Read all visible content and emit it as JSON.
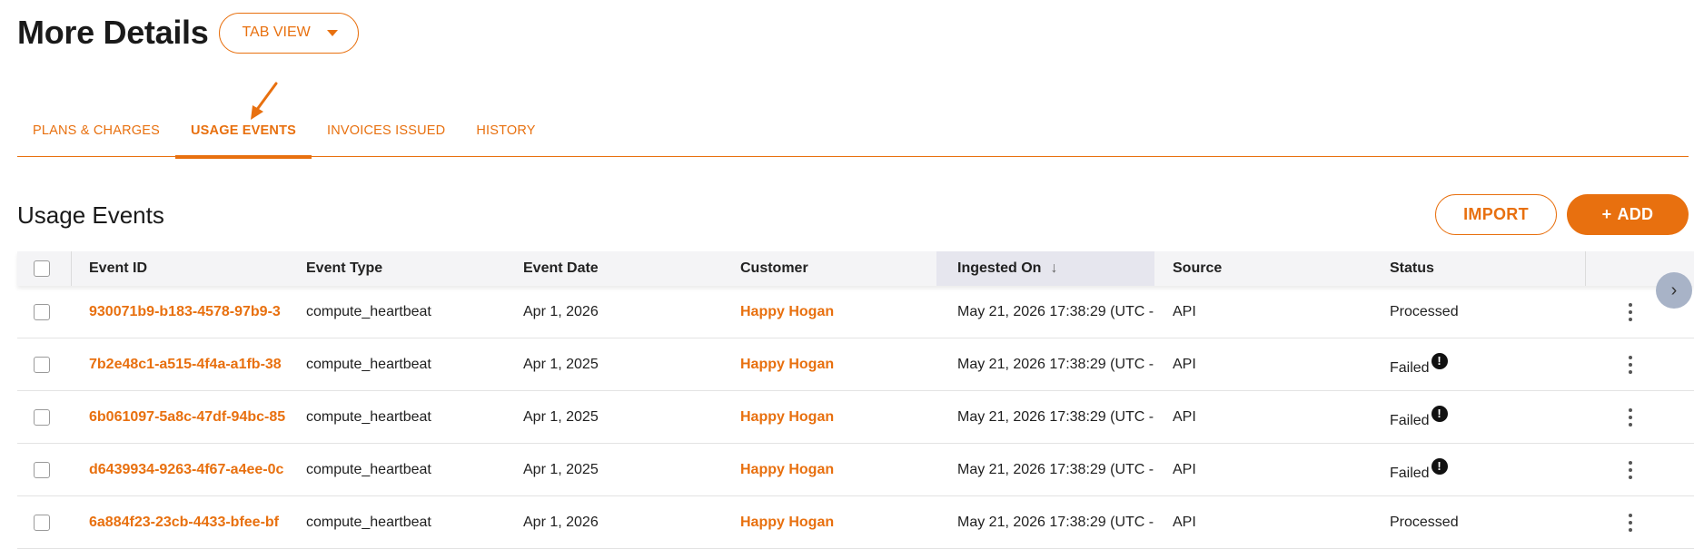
{
  "header": {
    "title": "More Details",
    "view_select": "TAB VIEW"
  },
  "tabs": [
    {
      "label": "PLANS & CHARGES",
      "active": false
    },
    {
      "label": "USAGE EVENTS",
      "active": true
    },
    {
      "label": "INVOICES ISSUED",
      "active": false
    },
    {
      "label": "HISTORY",
      "active": false
    }
  ],
  "section": {
    "title": "Usage Events",
    "import_label": "IMPORT",
    "add_label": "ADD",
    "add_icon": "plus-icon"
  },
  "table": {
    "columns": [
      "Event ID",
      "Event Type",
      "Event Date",
      "Customer",
      "Ingested On",
      "Source",
      "Status"
    ],
    "sort_icon": "arrow-down-icon",
    "rows": [
      {
        "id": "930071b9-b183-4578-97b9-3",
        "type": "compute_heartbeat",
        "date": "Apr 1, 2026",
        "customer": "Happy Hogan",
        "ingested": "May 21, 2026 17:38:29 (UTC -",
        "source": "API",
        "status": "Processed",
        "failed": false
      },
      {
        "id": "7b2e48c1-a515-4f4a-a1fb-38",
        "type": "compute_heartbeat",
        "date": "Apr 1, 2025",
        "customer": "Happy Hogan",
        "ingested": "May 21, 2026 17:38:29 (UTC -",
        "source": "API",
        "status": "Failed",
        "failed": true
      },
      {
        "id": "6b061097-5a8c-47df-94bc-85",
        "type": "compute_heartbeat",
        "date": "Apr 1, 2025",
        "customer": "Happy Hogan",
        "ingested": "May 21, 2026 17:38:29 (UTC -",
        "source": "API",
        "status": "Failed",
        "failed": true
      },
      {
        "id": "d6439934-9263-4f67-a4ee-0c",
        "type": "compute_heartbeat",
        "date": "Apr 1, 2025",
        "customer": "Happy Hogan",
        "ingested": "May 21, 2026 17:38:29 (UTC -",
        "source": "API",
        "status": "Failed",
        "failed": true
      },
      {
        "id": "6a884f23-23cb-4433-bfee-bf",
        "type": "compute_heartbeat",
        "date": "Apr 1, 2026",
        "customer": "Happy Hogan",
        "ingested": "May 21, 2026 17:38:29 (UTC -",
        "source": "API",
        "status": "Processed",
        "failed": false
      }
    ]
  },
  "colors": {
    "accent": "#e8700f",
    "header_bg": "#f4f4f6",
    "sorted_header_bg": "#e6e6ee"
  }
}
